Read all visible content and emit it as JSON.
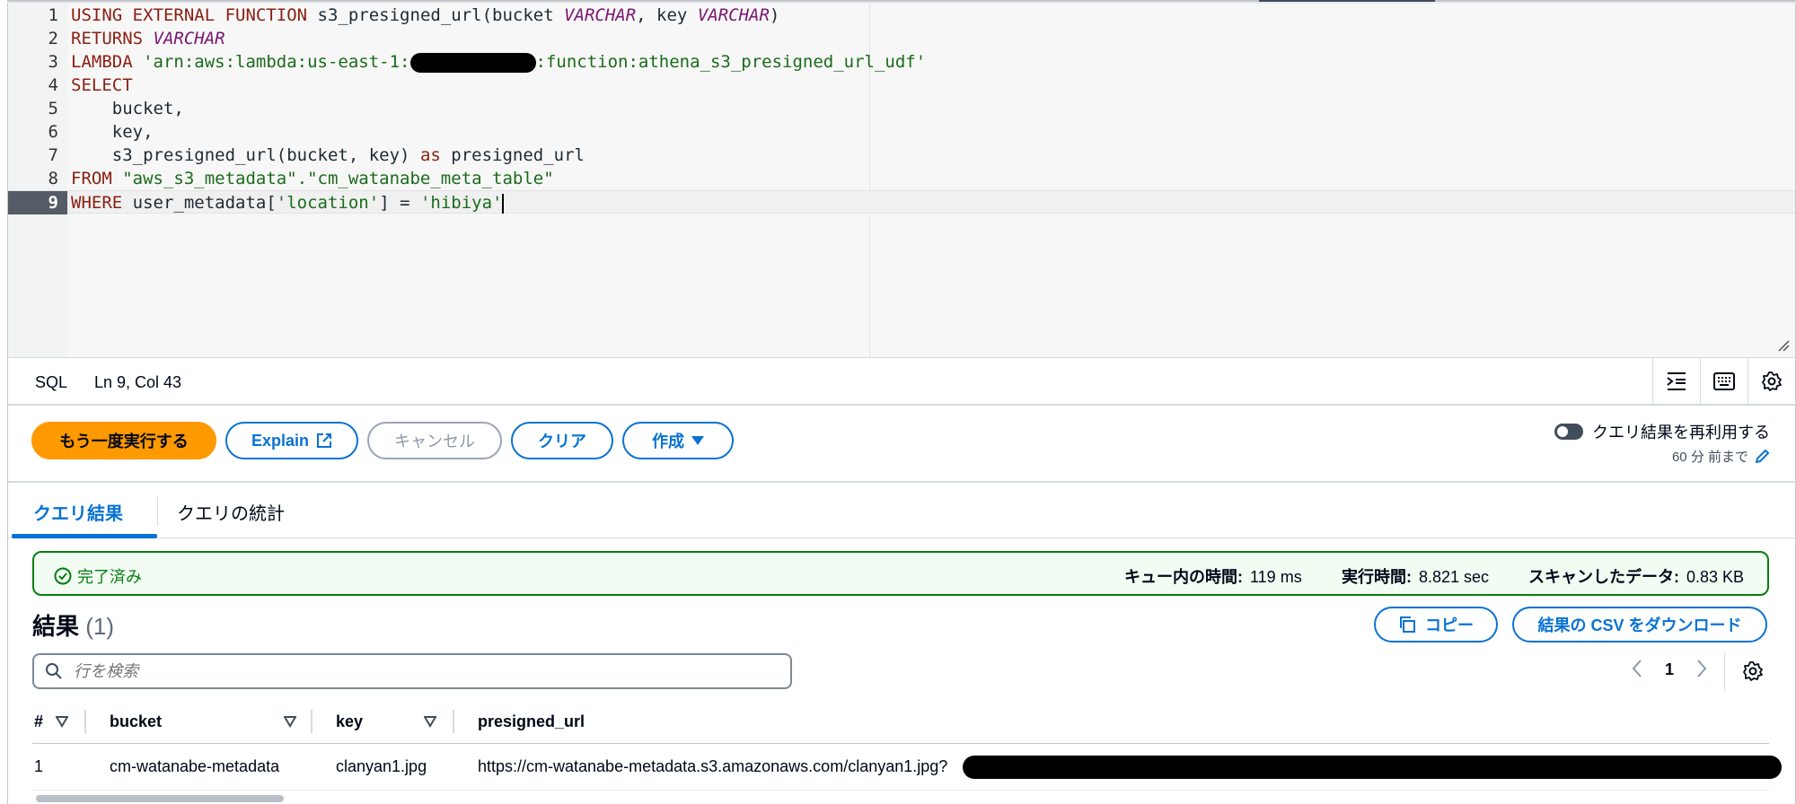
{
  "editor": {
    "lines": [
      {
        "n": "1"
      },
      {
        "n": "2"
      },
      {
        "n": "3"
      },
      {
        "n": "4"
      },
      {
        "n": "5"
      },
      {
        "n": "6"
      },
      {
        "n": "7"
      },
      {
        "n": "8"
      },
      {
        "n": "9"
      }
    ],
    "tokens": {
      "l1_kw": "USING EXTERNAL FUNCTION",
      "l1_name": " s3_presigned_url(bucket ",
      "l1_ty1": "VARCHAR",
      "l1_mid": ", key ",
      "l1_ty2": "VARCHAR",
      "l1_end": ")",
      "l2_kw": "RETURNS ",
      "l2_ty": "VARCHAR",
      "l3_kw": "LAMBDA ",
      "l3_str1": "'arn:aws:lambda:us-east-1:",
      "l3_str2": ":function:athena_s3_presigned_url_udf'",
      "l4_kw": "SELECT",
      "l5": "    bucket,",
      "l6": "    key,",
      "l7_a": "    s3_presigned_url(bucket, key) ",
      "l7_kw": "as",
      "l7_b": " presigned_url",
      "l8_kw": "FROM ",
      "l8_str": "\"aws_s3_metadata\".\"cm_watanabe_meta_table\"",
      "l9_kw": "WHERE",
      "l9_a": " user_metadata[",
      "l9_str1": "'location'",
      "l9_b": "] = ",
      "l9_str2": "'hibiya'"
    }
  },
  "statusbar": {
    "language": "SQL",
    "position": "Ln 9, Col 43"
  },
  "toolbar": {
    "run_again": "もう一度実行する",
    "explain": "Explain",
    "cancel": "キャンセル",
    "clear": "クリア",
    "create": "作成",
    "reuse_label": "クエリ結果を再利用する",
    "reuse_sub": "60 分 前まで"
  },
  "tabs": {
    "results": "クエリ結果",
    "stats": "クエリの統計"
  },
  "banner": {
    "status": "完了済み",
    "queue_label": "キュー内の時間:",
    "queue_value": "119 ms",
    "exec_label": "実行時間:",
    "exec_value": "8.821 sec",
    "scan_label": "スキャンしたデータ:",
    "scan_value": "0.83 KB",
    "success_color": "#037f0c"
  },
  "results": {
    "title": "結果",
    "count": "(1)",
    "copy": "コピー",
    "download": "結果の CSV をダウンロード",
    "search_placeholder": "行を検索",
    "page": "1"
  },
  "table": {
    "headers": [
      "#",
      "bucket",
      "key",
      "presigned_url"
    ],
    "rows": [
      [
        "1",
        "cm-watanabe-metadata",
        "clanyan1.jpg",
        "https://cm-watanabe-metadata.s3.amazonaws.com/clanyan1.jpg?"
      ]
    ]
  },
  "colors": {
    "accent": "#0972d3",
    "primary_button": "#ff9900"
  }
}
